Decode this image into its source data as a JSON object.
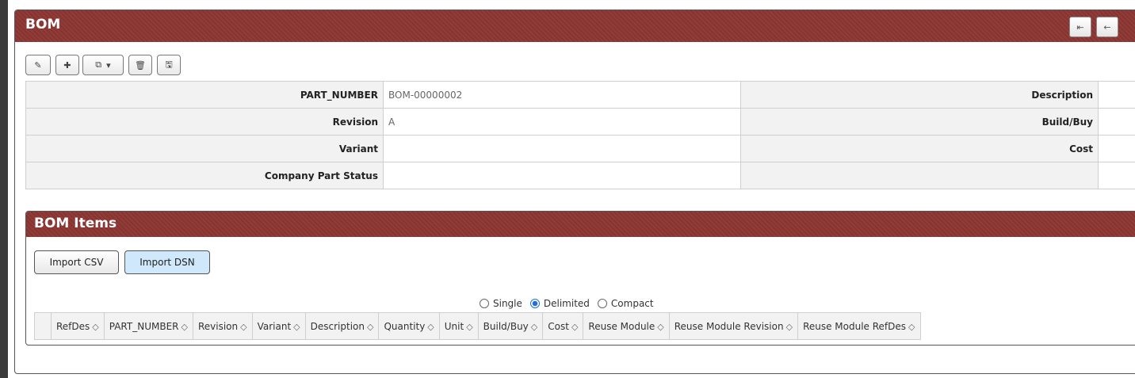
{
  "panel": {
    "title": "BOM",
    "head_buttons": {
      "first_icon": "⇤",
      "back_icon": "←"
    }
  },
  "toolbar": {
    "edit_icon": "✎",
    "add_icon": "✚",
    "copy_icon": "⧉",
    "copy_caret": "▾",
    "delete_icon": "🗑",
    "save_icon": "🖫"
  },
  "properties": {
    "rows": [
      {
        "label": "PART_NUMBER",
        "value": "BOM-00000002",
        "right_label": "Description",
        "right_value": ""
      },
      {
        "label": "Revision",
        "value": "A",
        "right_label": "Build/Buy",
        "right_value": ""
      },
      {
        "label": "Variant",
        "value": "",
        "right_label": "Cost",
        "right_value": ""
      },
      {
        "label": "Company Part Status",
        "value": "",
        "right_label": "",
        "right_value": ""
      }
    ]
  },
  "bom_items": {
    "title": "BOM Items",
    "import_csv": "Import CSV",
    "import_dsn": "Import DSN",
    "modes": {
      "single": "Single",
      "delimited": "Delimited",
      "compact": "Compact",
      "selected": "Delimited"
    },
    "sort_icon": "◇",
    "columns": [
      "RefDes",
      "PART_NUMBER",
      "Revision",
      "Variant",
      "Description",
      "Quantity",
      "Unit",
      "Build/Buy",
      "Cost",
      "Reuse Module",
      "Reuse Module Revision",
      "Reuse Module RefDes"
    ]
  },
  "colors": {
    "header": "#8c3633",
    "import_dsn_bg": "#cfe8fb"
  }
}
